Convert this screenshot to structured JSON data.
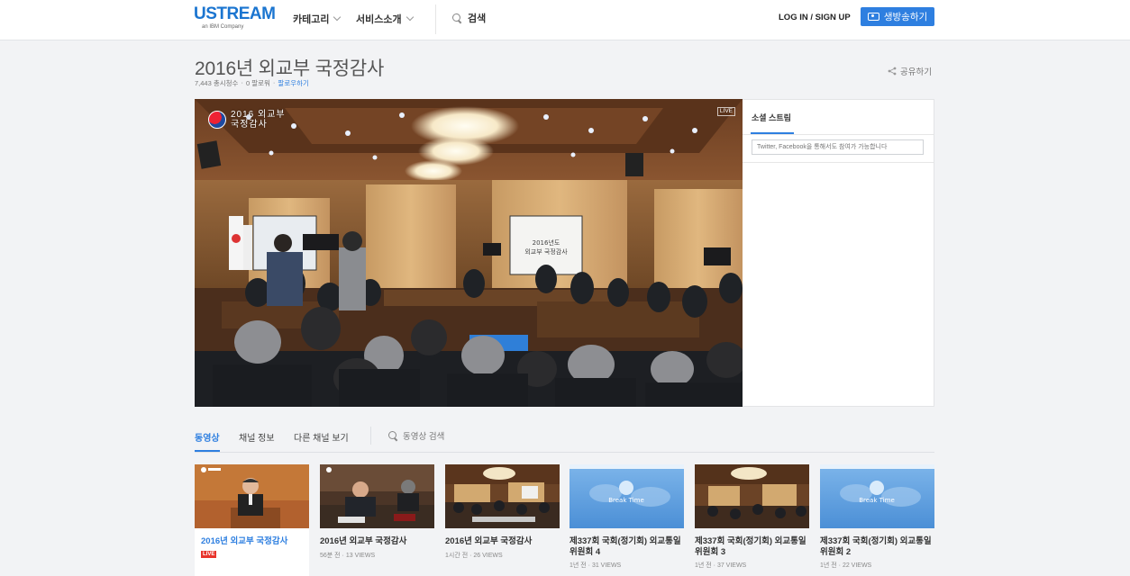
{
  "header": {
    "logo": "USTREAM",
    "logo_sub": "an IBM Company",
    "nav": [
      {
        "label": "카테고리"
      },
      {
        "label": "서비스소개"
      }
    ],
    "search_label": "검색",
    "login_label": "LOG IN / SIGN UP",
    "broadcast_label": "생방송하기"
  },
  "channel": {
    "title": "2016년 외교부 국정감사",
    "views": "7,443 총시청수",
    "likes": "0 팔로워",
    "follow_label": "팔로우하기",
    "share_label": "공유하기"
  },
  "player": {
    "live_tag": "LIVE",
    "broadcaster_line1": "2016 외교부",
    "broadcaster_line2": "국정감사",
    "screen_text_line1": "2016년도",
    "screen_text_line2": "외교부 국정감사"
  },
  "social": {
    "tab_label": "소셜 스트림",
    "input_placeholder": "Twitter, Facebook을 통해서도 참여가 가능합니다"
  },
  "tabs": {
    "items": [
      "동영상",
      "채널 정보",
      "다른 채널 보기"
    ],
    "search_label": "동영상 검색"
  },
  "videos": [
    {
      "title": "2016년 외교부 국정감사",
      "live": "LIVE",
      "meta": "",
      "thumb": "speaker"
    },
    {
      "title": "2016년 외교부 국정감사",
      "live": "",
      "meta": "56분 전 · 13 VIEWS",
      "thumb": "desk"
    },
    {
      "title": "2016년 외교부 국정감사",
      "live": "",
      "meta": "1시간 전 · 26 VIEWS",
      "thumb": "hall"
    },
    {
      "title": "제337회 국회(정기회) 외교통일위원회 4",
      "live": "",
      "meta": "1년 전 · 31 VIEWS",
      "thumb": "break"
    },
    {
      "title": "제337회 국회(정기회) 외교통일위원회 3",
      "live": "",
      "meta": "1년 전 · 37 VIEWS",
      "thumb": "hall2"
    },
    {
      "title": "제337회 국회(정기회) 외교통일위원회 2",
      "live": "",
      "meta": "1년 전 · 22 VIEWS",
      "thumb": "break"
    }
  ],
  "break_time_label": "Break Time",
  "colors": {
    "accent": "#2e7fe0",
    "live": "#e8332b",
    "background": "#f2f3f5"
  }
}
